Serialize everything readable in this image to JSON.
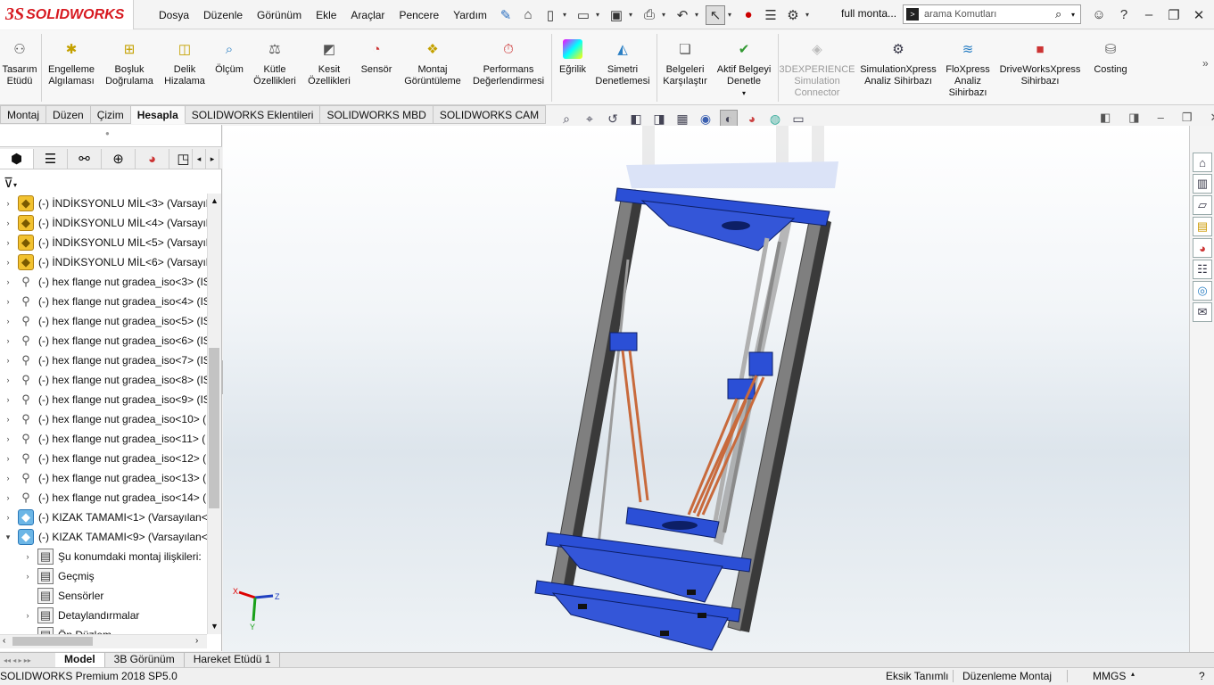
{
  "app": {
    "brand_mark": "3S",
    "brand_name": "SOLIDWORKS",
    "doc_title": "full monta..."
  },
  "menu": [
    "Dosya",
    "Düzenle",
    "Görünüm",
    "Ekle",
    "Araçlar",
    "Pencere",
    "Yardım"
  ],
  "search": {
    "placeholder": "arama Komutları"
  },
  "ribbon": {
    "motion_study": "Tasarım Etüdü",
    "interference": "Engelleme Algılaması",
    "clearance": "Boşluk Doğrulama",
    "hole_align": "Delik Hizalama",
    "measure": "Ölçüm",
    "mass_props": "Kütle Özellikleri",
    "section_props": "Kesit Özellikleri",
    "sensor": "Sensör",
    "assembly_viz": "Montaj Görüntüleme",
    "perf_eval": "Performans Değerlendirmesi",
    "curvature": "Eğrilik",
    "symmetry": "Simetri Denetlemesi",
    "compare": "Belgeleri Karşılaştır",
    "active_check": "Aktif Belgeyi Denetle",
    "experience": "3DEXPERIENCE Simulation Connector",
    "simxpress": "SimulationXpress Analiz Sihirbazı",
    "floxpress": "FloXpress Analiz Sihirbazı",
    "driveworks": "DriveWorksXpress Sihirbazı",
    "costing": "Costing"
  },
  "tabs": [
    "Montaj",
    "Düzen",
    "Çizim",
    "Hesapla",
    "SOLIDWORKS Eklentileri",
    "SOLIDWORKS MBD",
    "SOLIDWORKS CAM"
  ],
  "active_tab": "Hesapla",
  "tree": [
    {
      "label": "(-) İNDİKSYONLU MİL<3> (Varsayıla",
      "icon": "part"
    },
    {
      "label": "(-) İNDİKSYONLU MİL<4> (Varsayıla",
      "icon": "part"
    },
    {
      "label": "(-) İNDİKSYONLU MİL<5> (Varsayıla",
      "icon": "part"
    },
    {
      "label": "(-) İNDİKSYONLU MİL<6> (Varsayıla",
      "icon": "part"
    },
    {
      "label": "(-) hex flange nut gradea_iso<3> (IS",
      "icon": "bolt"
    },
    {
      "label": "(-) hex flange nut gradea_iso<4> (IS",
      "icon": "bolt"
    },
    {
      "label": "(-) hex flange nut gradea_iso<5> (IS",
      "icon": "bolt"
    },
    {
      "label": "(-) hex flange nut gradea_iso<6> (IS",
      "icon": "bolt"
    },
    {
      "label": "(-) hex flange nut gradea_iso<7> (IS",
      "icon": "bolt"
    },
    {
      "label": "(-) hex flange nut gradea_iso<8> (IS",
      "icon": "bolt"
    },
    {
      "label": "(-) hex flange nut gradea_iso<9> (IS",
      "icon": "bolt"
    },
    {
      "label": "(-) hex flange nut gradea_iso<10> (",
      "icon": "bolt"
    },
    {
      "label": "(-) hex flange nut gradea_iso<11> (",
      "icon": "bolt"
    },
    {
      "label": "(-) hex flange nut gradea_iso<12> (",
      "icon": "bolt"
    },
    {
      "label": "(-) hex flange nut gradea_iso<13> (",
      "icon": "bolt"
    },
    {
      "label": "(-) hex flange nut gradea_iso<14> (",
      "icon": "bolt"
    },
    {
      "label": "(-) KIZAK TAMAMI<1> (Varsayılan<",
      "icon": "asm"
    },
    {
      "label": "(-) KIZAK TAMAMI<9> (Varsayılan<",
      "icon": "asm",
      "expanded": true
    },
    {
      "label": "Şu konumdaki montaj ilişkileri:",
      "icon": "folder",
      "child": true
    },
    {
      "label": "Geçmiş",
      "icon": "folder",
      "child": true
    },
    {
      "label": "Sensörler",
      "icon": "folder",
      "child": true,
      "noexp": true
    },
    {
      "label": "Detaylandırmalar",
      "icon": "folder",
      "child": true
    },
    {
      "label": "Ön Düzlem",
      "icon": "folder",
      "child": true,
      "noexp": true
    }
  ],
  "bottom_tabs": [
    "Model",
    "3B Görünüm",
    "Hareket Etüdü 1"
  ],
  "status": {
    "product": "SOLIDWORKS Premium 2018 SP5.0",
    "definition": "Eksik Tanımlı",
    "mode": "Düzenleme Montaj",
    "units": "MMGS"
  },
  "triad": {
    "x": "X",
    "y": "Y",
    "z": "Z"
  },
  "colors": {
    "model_blue": "#2b4fd6",
    "rail": "#8a8a8a",
    "rod": "#c86a3c",
    "brand": "#d71920"
  }
}
